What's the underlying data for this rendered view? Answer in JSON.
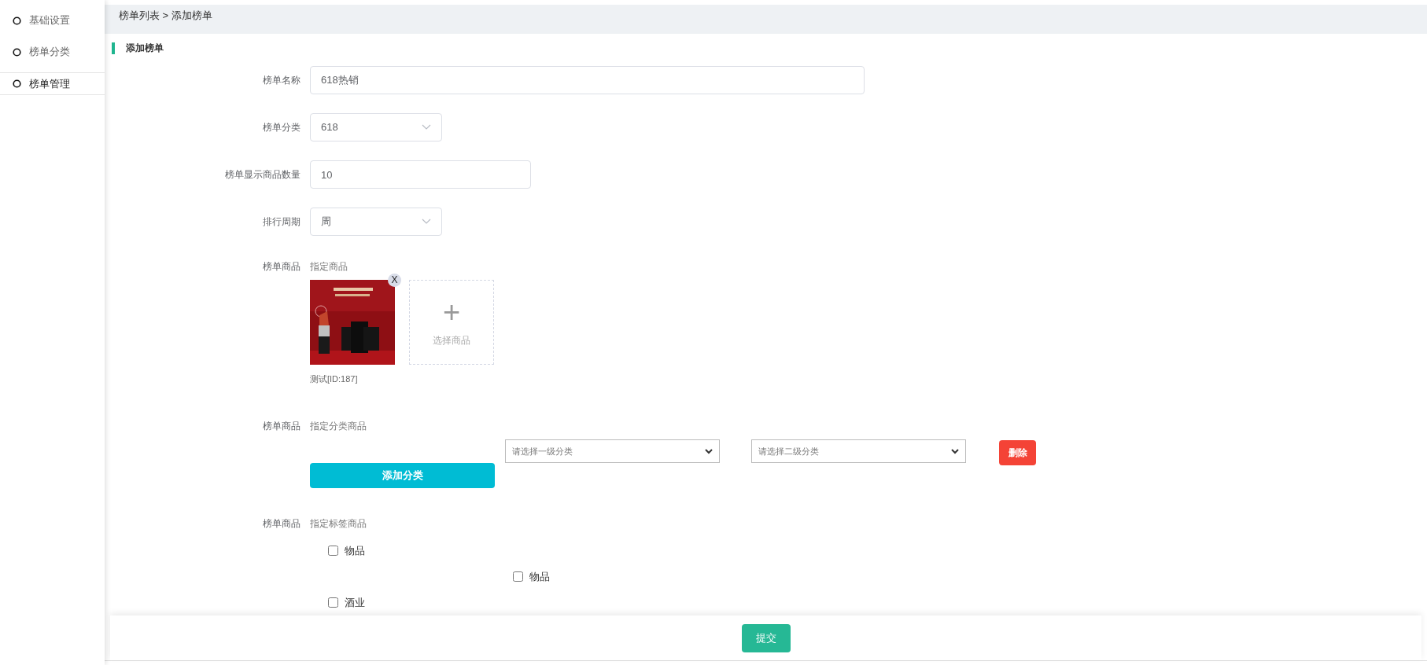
{
  "sidebar": {
    "items": [
      {
        "label": "基础设置",
        "selected": false
      },
      {
        "label": "榜单分类",
        "selected": false
      },
      {
        "label": "榜单管理",
        "selected": true
      }
    ]
  },
  "breadcrumb": "榜单列表 > 添加榜单",
  "section_title": "添加榜单",
  "fields": [
    {
      "kind": "text",
      "label": "榜单名称",
      "value": "618热销"
    },
    {
      "kind": "select",
      "label": "榜单分类",
      "value": "618"
    },
    {
      "kind": "number",
      "label": "榜单显示商品数量",
      "value": "10"
    },
    {
      "kind": "select",
      "label": "排行周期",
      "value": "周"
    }
  ],
  "product_section": {
    "label": "榜单商品",
    "mode": "指定商品",
    "products": [
      {
        "caption": "测试[ID:187]",
        "remove": "X",
        "kind": "picture"
      }
    ],
    "add_label": "选择商品",
    "add_icon": "+"
  },
  "category_section": {
    "label": "榜单商品",
    "mode": "指定分类商品",
    "rows": [
      {
        "first_placeholder": "请选择一级分类",
        "second_placeholder": "请选择二级分类",
        "delete": "删除"
      }
    ],
    "add_button": "添加分类"
  },
  "tag_section": {
    "label": "榜单商品",
    "mode": "指定标签商品",
    "tags": [
      {
        "label": "物品",
        "checked": false,
        "children": [
          {
            "label": "物品",
            "checked": false
          }
        ]
      },
      {
        "label": "酒业",
        "checked": false
      }
    ]
  },
  "submit": "提交"
}
